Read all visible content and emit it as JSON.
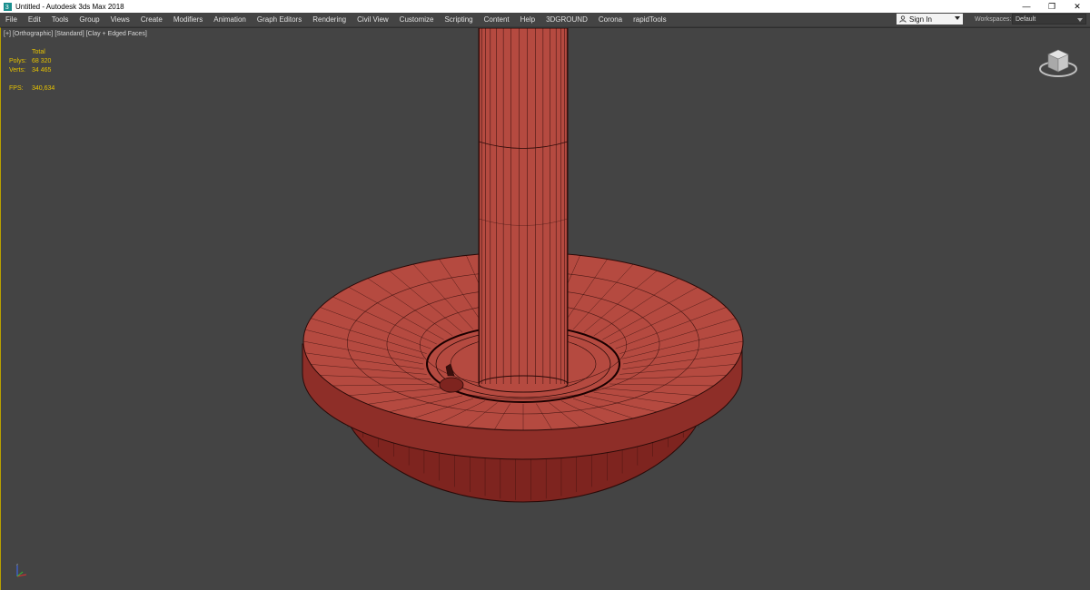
{
  "window": {
    "title": "Untitled - Autodesk 3ds Max 2018",
    "controls": {
      "minimize": "—",
      "restore": "❐",
      "close": "✕"
    }
  },
  "menubar": {
    "items": [
      "File",
      "Edit",
      "Tools",
      "Group",
      "Views",
      "Create",
      "Modifiers",
      "Animation",
      "Graph Editors",
      "Rendering",
      "Civil View",
      "Customize",
      "Scripting",
      "Content",
      "Help",
      "3DGROUND",
      "Corona",
      "rapidTools"
    ],
    "sign_in": "Sign In",
    "workspaces_label": "Workspaces:",
    "workspace_value": "Default"
  },
  "viewport": {
    "labels": [
      "[+]",
      "[Orthographic]",
      "[Standard]",
      "[Clay + Edged Faces]"
    ],
    "stats": {
      "header": "Total",
      "polys_label": "Polys:",
      "polys_value": "68 320",
      "verts_label": "Verts:",
      "verts_value": "34 465",
      "fps_label": "FPS:",
      "fps_value": "340,634"
    }
  },
  "icons": {
    "app": "3dsmax-app-icon",
    "user": "user-icon",
    "viewcube": "viewcube-icon",
    "axis": "axis-tripod-icon"
  },
  "colors": {
    "viewport_bg": "#444444",
    "model": "#b54a40",
    "model_dark": "#7e241f",
    "wire": "#2a0a08",
    "stats_text": "#e6c200",
    "active_border": "#b8a000"
  }
}
